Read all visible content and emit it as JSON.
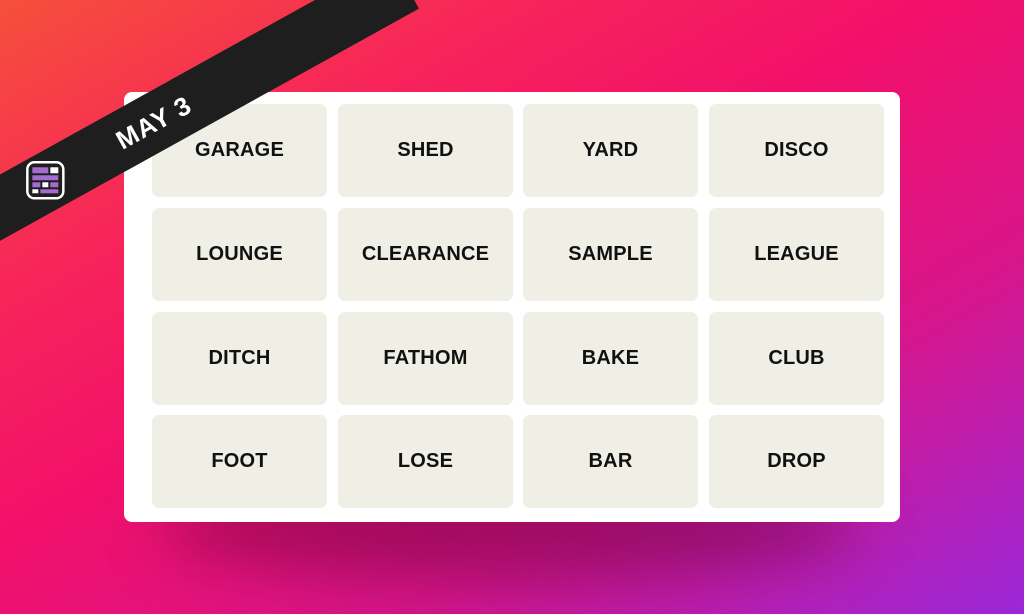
{
  "banner": {
    "date": "MAY 3",
    "icon": "connections-grid-icon",
    "background": "#1e1e1e",
    "icon_color": "#a66bd1"
  },
  "board": {
    "tiles": [
      "GARAGE",
      "SHED",
      "YARD",
      "DISCO",
      "LOUNGE",
      "CLEARANCE",
      "SAMPLE",
      "LEAGUE",
      "DITCH",
      "FATHOM",
      "BAKE",
      "CLUB",
      "FOOT",
      "LOSE",
      "BAR",
      "DROP"
    ],
    "tile_color": "#efefe6"
  }
}
